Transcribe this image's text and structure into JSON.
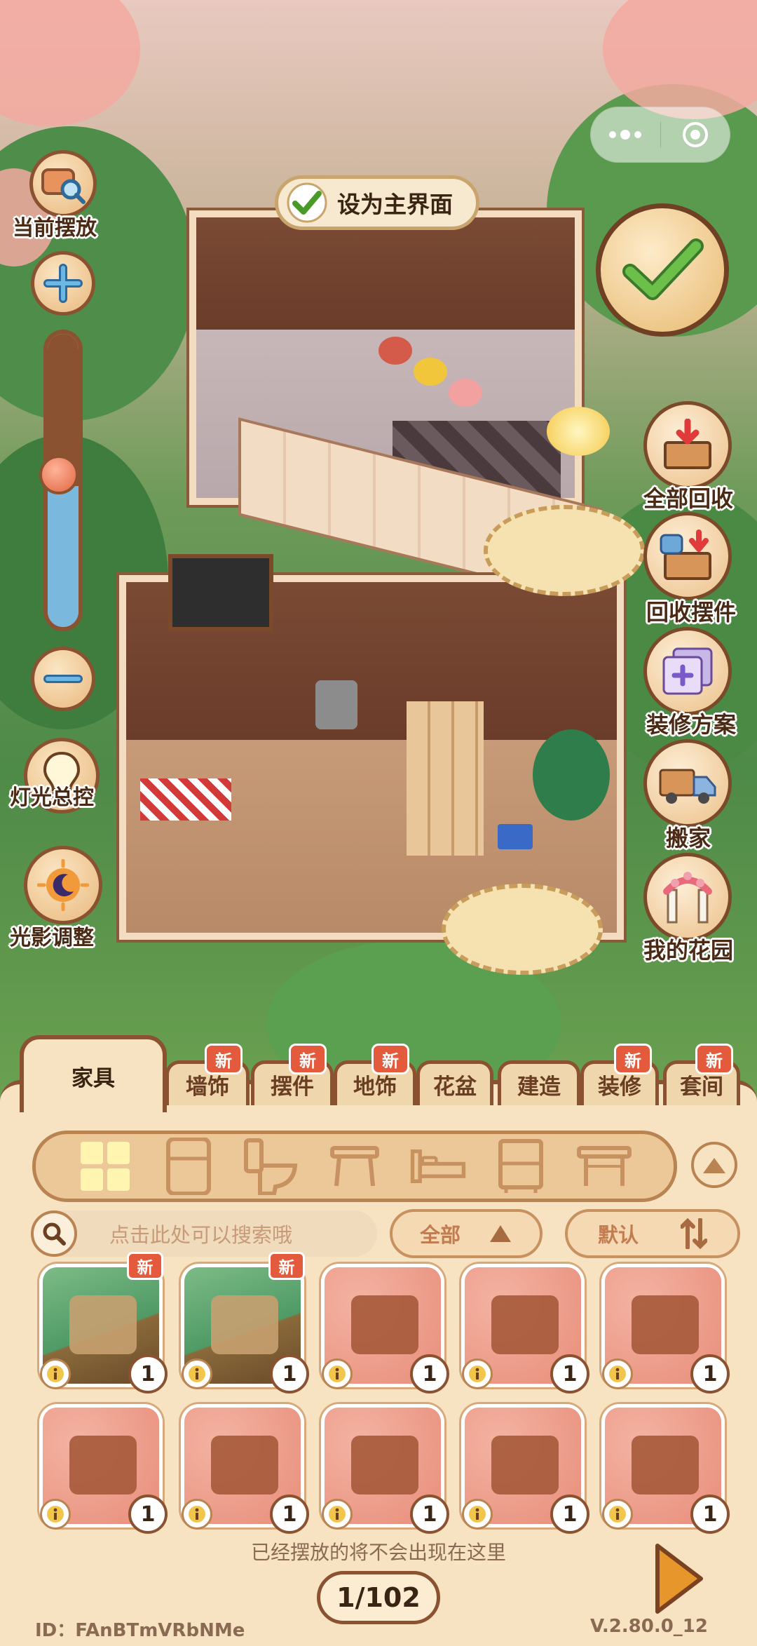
{
  "header": {
    "set_main_label": "设为主界面"
  },
  "left_hud": {
    "current_place_label": "当前摆放",
    "light_label": "灯光总控",
    "shadow_label": "光影调整",
    "zoom_level": 0.48
  },
  "right_hud": {
    "items": [
      {
        "label": "全部回收",
        "icon": "recycle-all-icon"
      },
      {
        "label": "回收摆件",
        "icon": "recycle-ornament-icon"
      },
      {
        "label": "装修方案",
        "icon": "decor-plan-icon"
      },
      {
        "label": "搬家",
        "icon": "moving-truck-icon"
      },
      {
        "label": "我的花园",
        "icon": "garden-arch-icon"
      }
    ]
  },
  "tabs": {
    "active": "家具",
    "items": [
      {
        "label": "墙饰",
        "new": "新"
      },
      {
        "label": "摆件",
        "new": "新"
      },
      {
        "label": "地饰",
        "new": "新"
      },
      {
        "label": "花盆",
        "new": ""
      },
      {
        "label": "建造",
        "new": ""
      },
      {
        "label": "装修",
        "new": "新"
      },
      {
        "label": "套间",
        "new": "新"
      }
    ]
  },
  "categories": [
    "all-grid-icon",
    "fridge-icon",
    "toilet-icon",
    "stool-icon",
    "bed-icon",
    "cabinet-icon",
    "table-icon"
  ],
  "search": {
    "placeholder": "点击此处可以搜索哦",
    "filter_label": "全部",
    "sort_label": "默认"
  },
  "items": [
    {
      "name": "bookshelf-arch-item",
      "count": "1",
      "new": "新",
      "bg": "green"
    },
    {
      "name": "swan-bed-item",
      "count": "1",
      "new": "新",
      "bg": "green"
    },
    {
      "name": "wooden-table-item",
      "count": "1",
      "new": "",
      "bg": "pink"
    },
    {
      "name": "maple-waterfall-item",
      "count": "1",
      "new": "",
      "bg": "pink"
    },
    {
      "name": "flower-arch-item",
      "count": "1",
      "new": "",
      "bg": "pink"
    },
    {
      "name": "maple-fence-item",
      "count": "1",
      "new": "",
      "bg": "pink"
    },
    {
      "name": "wooden-platform-item",
      "count": "1",
      "new": "",
      "bg": "pink"
    },
    {
      "name": "log-bench-item",
      "count": "1",
      "new": "",
      "bg": "pink"
    },
    {
      "name": "yak-item",
      "count": "1",
      "new": "",
      "bg": "pink"
    },
    {
      "name": "waterfall-pillar-item",
      "count": "1",
      "new": "",
      "bg": "pink"
    }
  ],
  "footer": {
    "hint": "已经摆放的将不会出现在这里",
    "page": "1/102",
    "user_id": "ID：FAnBTmVRbNMe",
    "version": "V.2.80.0_12"
  },
  "colors": {
    "accent_brown": "#8a5230",
    "panel_bg": "#f7e3c2",
    "badge_red": "#e45a3c",
    "check_green": "#5aa83a"
  }
}
